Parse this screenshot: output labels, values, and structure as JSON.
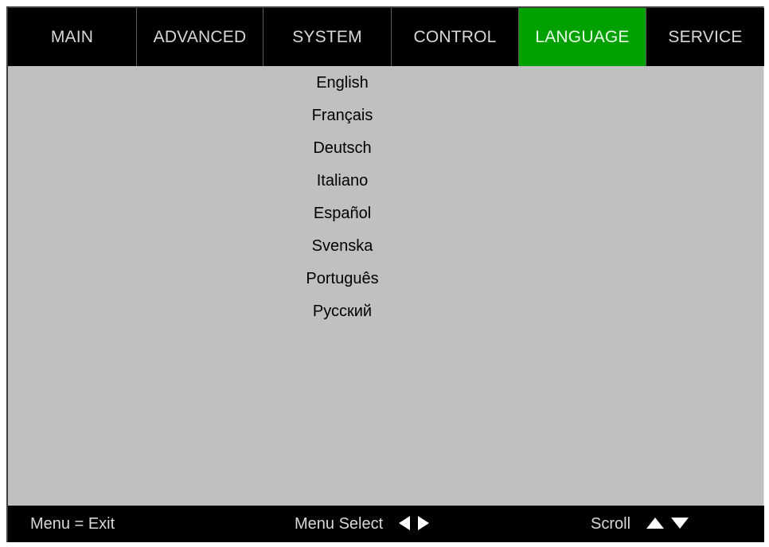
{
  "tabs": [
    {
      "label": "MAIN",
      "active": false
    },
    {
      "label": "ADVANCED",
      "active": false
    },
    {
      "label": "SYSTEM",
      "active": false
    },
    {
      "label": "CONTROL",
      "active": false
    },
    {
      "label": "LANGUAGE",
      "active": true
    },
    {
      "label": "SERVICE",
      "active": false
    }
  ],
  "languages": [
    "English",
    "Français",
    "Deutsch",
    "Italiano",
    "Español",
    "Svenska",
    "Português",
    "Русский"
  ],
  "statusbar": {
    "exit_hint": "Menu = Exit",
    "menu_select_label": "Menu Select",
    "scroll_label": "Scroll"
  },
  "colors": {
    "menu_background": "#c0c0c0",
    "bar_background": "#000000",
    "active_tab": "#00a000",
    "bar_text": "#d8d8d8"
  },
  "icons": {
    "menu_select": [
      "left-arrow-icon",
      "right-arrow-icon"
    ],
    "scroll": [
      "up-arrow-icon",
      "down-arrow-icon"
    ]
  }
}
